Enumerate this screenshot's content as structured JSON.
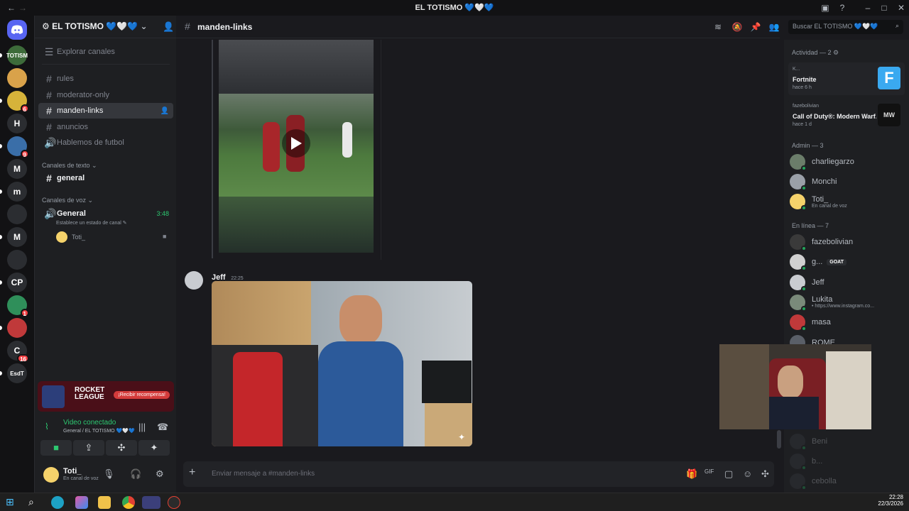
{
  "window": {
    "title": "EL TOTISMO 💙🤍💙"
  },
  "server": {
    "name": "EL TOTISMO 💙🤍💙",
    "explore_label": "Explorar canales"
  },
  "channels": [
    {
      "name": "rules",
      "type": "text"
    },
    {
      "name": "moderator-only",
      "type": "text"
    },
    {
      "name": "manden-links",
      "type": "text",
      "active": true
    },
    {
      "name": "anuncios",
      "type": "text"
    },
    {
      "name": "Hablemos de futbol",
      "type": "voice-text"
    }
  ],
  "categories": {
    "text": "Canales de texto",
    "voice": "Canales de voz"
  },
  "text_channels": [
    {
      "name": "general"
    }
  ],
  "voice_channel": {
    "name": "General",
    "time": "3:48",
    "status_placeholder": "Establece un estado de canal",
    "member": "Toti_"
  },
  "servers": [
    {
      "label": "TOTISM",
      "badge": ""
    },
    {
      "label": "",
      "badge": ""
    },
    {
      "label": "",
      "badge": "6"
    },
    {
      "label": "H",
      "badge": ""
    },
    {
      "label": "",
      "badge": "9"
    },
    {
      "label": "M",
      "badge": ""
    },
    {
      "label": "m",
      "badge": ""
    },
    {
      "label": "",
      "badge": ""
    },
    {
      "label": "M",
      "badge": ""
    },
    {
      "label": "",
      "badge": ""
    },
    {
      "label": "CP",
      "badge": ""
    },
    {
      "label": "",
      "badge": "1"
    },
    {
      "label": "",
      "badge": ""
    },
    {
      "label": "C",
      "badge": "16"
    },
    {
      "label": "EsdT",
      "badge": ""
    }
  ],
  "promo": {
    "game": "ROCKET LEAGUE",
    "cta": "¡Recibir recompensa!"
  },
  "voice_status": {
    "title": "Video conectado",
    "subtitle": "General / EL TOTISMO 💙🤍💙"
  },
  "user": {
    "name": "Toti_",
    "status": "En canal de voz"
  },
  "header": {
    "channel": "manden-links",
    "search_placeholder": "Buscar EL TOTISMO 💙🤍💙"
  },
  "messages": [
    {
      "author": "Jeff",
      "time": "22:25"
    }
  ],
  "composer": {
    "placeholder": "Enviar mensaje a #manden-links"
  },
  "members": {
    "activity_header": "Actividad — 2",
    "activities": [
      {
        "user": "K...",
        "game": "Fortnite",
        "when": "hace 6 h"
      },
      {
        "user": "fazebolivian",
        "game": "Call of Duty®: Modern Warf...",
        "when": "hace 1 d"
      }
    ],
    "admin_header": "Admin — 3",
    "admins": [
      {
        "name": "charliegarzo",
        "sub": ""
      },
      {
        "name": "Monchi",
        "sub": ""
      },
      {
        "name": "Toti_",
        "sub": "En canal de voz"
      }
    ],
    "online_header": "En línea — 7",
    "online": [
      {
        "name": "fazebolivian",
        "sub": "",
        "tag": ""
      },
      {
        "name": "g...",
        "sub": "",
        "tag": "GOAT"
      },
      {
        "name": "Jeff",
        "sub": "",
        "tag": ""
      },
      {
        "name": "Lukita",
        "sub": "• https://www.instagram.co...",
        "tag": ""
      },
      {
        "name": "masa",
        "sub": "",
        "tag": ""
      },
      {
        "name": "ROME",
        "sub": "",
        "tag": ""
      }
    ],
    "offline": [
      {
        "name": "Beni"
      },
      {
        "name": "b..."
      },
      {
        "name": "cebolla"
      }
    ]
  },
  "clock": {
    "time": "22:28",
    "date": "22/3/2026"
  },
  "colors": {
    "accent": "#5865f2",
    "online": "#23a55a",
    "danger": "#f23f43",
    "voice_green": "#2dc770"
  }
}
